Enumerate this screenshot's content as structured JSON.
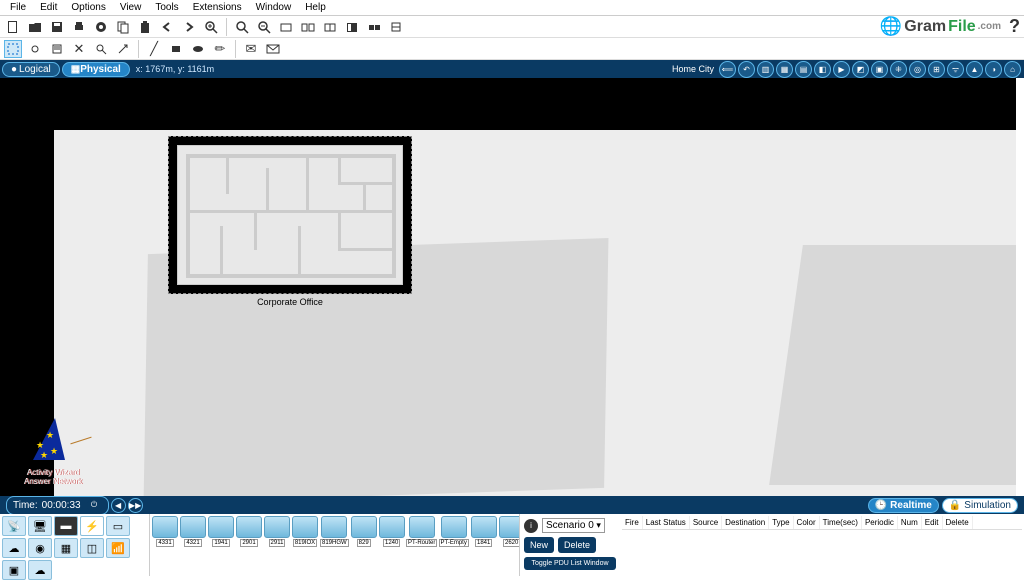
{
  "menu": [
    "File",
    "Edit",
    "Options",
    "View",
    "Tools",
    "Extensions",
    "Window",
    "Help"
  ],
  "logo": {
    "gram": "Gram",
    "file": "File",
    "com": ".com"
  },
  "view": {
    "logical": "Logical",
    "physical": "Physical",
    "coords": "x: 1767m, y: 1161m",
    "city": "Home City"
  },
  "office_label": "Corporate Office",
  "wizard": {
    "line1": "Activity Wizard",
    "line2": "Answer Network"
  },
  "time": {
    "label": "Time:",
    "value": "00:00:33"
  },
  "modes": {
    "realtime": "Realtime",
    "simulation": "Simulation"
  },
  "devices": [
    "4331",
    "4321",
    "1941",
    "2901",
    "2911",
    "819IOX",
    "819HGW",
    "829",
    "1240",
    "PT-Router",
    "PT-Empty",
    "1841",
    "2620"
  ],
  "scenario": {
    "label": "Scenario 0",
    "info": "i"
  },
  "buttons": {
    "new": "New",
    "delete": "Delete",
    "toggle": "Toggle PDU List Window"
  },
  "pdu_cols": [
    "Fire",
    "Last Status",
    "Source",
    "Destination",
    "Type",
    "Color",
    "Time(sec)",
    "Periodic",
    "Num",
    "Edit",
    "Delete"
  ]
}
